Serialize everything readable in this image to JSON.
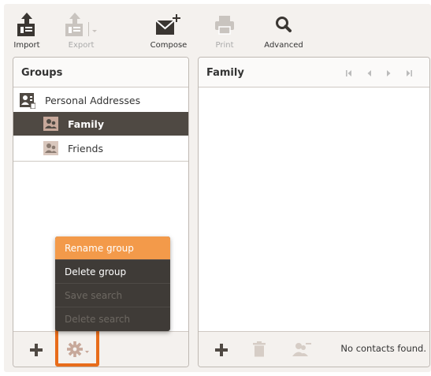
{
  "toolbar": {
    "import_label": "Import",
    "export_label": "Export",
    "compose_label": "Compose",
    "print_label": "Print",
    "advanced_label": "Advanced"
  },
  "groups_panel": {
    "title": "Groups",
    "items": [
      {
        "label": "Personal Addresses",
        "icon": "address-book-icon",
        "selected": false
      },
      {
        "label": "Family",
        "icon": "group-icon",
        "selected": true
      },
      {
        "label": "Friends",
        "icon": "group-icon",
        "selected": false
      }
    ]
  },
  "context_menu": {
    "items": [
      {
        "label": "Rename group",
        "state": "active"
      },
      {
        "label": "Delete group",
        "state": "enabled"
      },
      {
        "label": "Save search",
        "state": "disabled"
      },
      {
        "label": "Delete search",
        "state": "disabled"
      }
    ]
  },
  "contacts_panel": {
    "title": "Family",
    "status": "No contacts found."
  },
  "colors": {
    "accent": "#f39a4a",
    "highlight_border": "#e86c1a",
    "selected_row": "#4f4943",
    "menu_bg": "#3f3b37"
  }
}
